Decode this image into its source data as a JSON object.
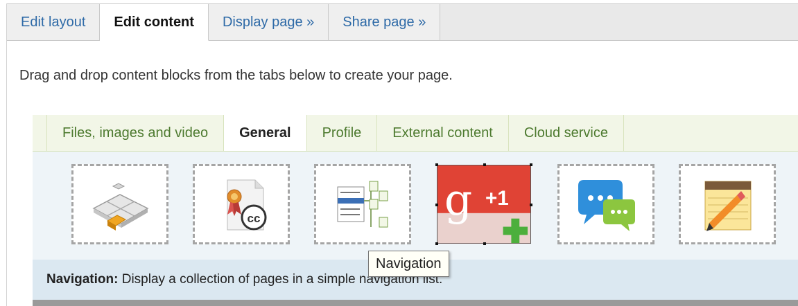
{
  "top_tabs": [
    {
      "label": "Edit layout"
    },
    {
      "label": "Edit content"
    },
    {
      "label": "Display page »"
    },
    {
      "label": "Share page »"
    }
  ],
  "instructions": "Drag and drop content blocks from the tabs below to create your page.",
  "inner_tabs": [
    {
      "label": "Files, images and video"
    },
    {
      "label": "General"
    },
    {
      "label": "Profile"
    },
    {
      "label": "External content"
    },
    {
      "label": "Cloud service"
    }
  ],
  "blocks": {
    "icons": [
      "puzzle-pieces-icon",
      "creative-commons-license-icon",
      "navigation-list-icon",
      "google-plus-one-icon",
      "comments-icon",
      "notepad-pencil-icon"
    ],
    "gplus_text": "+1",
    "cc_text": "cc"
  },
  "tooltip": "Navigation",
  "description": {
    "title": "Navigation:",
    "text": "Display a collection of pages in a simple navigation list."
  },
  "colors": {
    "link_blue": "#2e6aa7",
    "tab_green": "#4d7a2f",
    "google_red": "#e04335",
    "add_green": "#4caf3c"
  }
}
